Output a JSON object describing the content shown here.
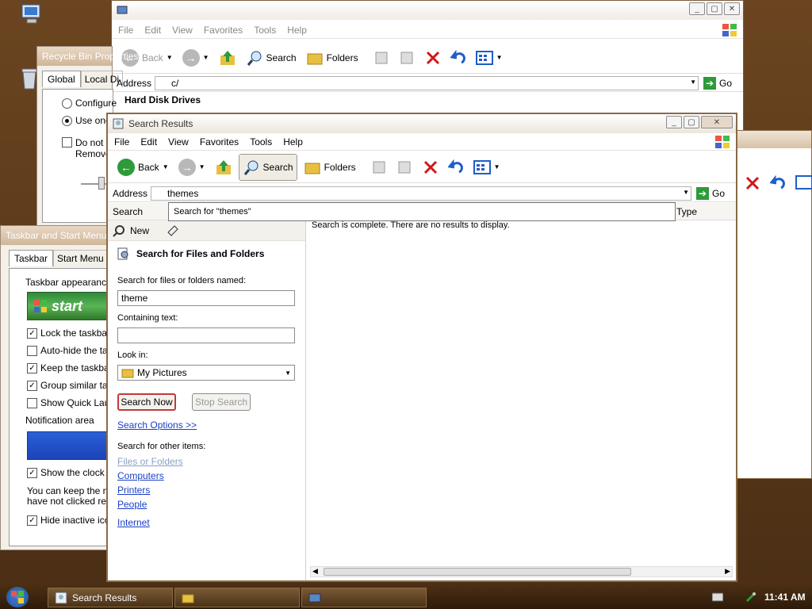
{
  "colors": {
    "accent": "#1a3fc7",
    "go": "#2e9a3a",
    "delete": "#d01818"
  },
  "back_window": {
    "menu": [
      "File",
      "Edit",
      "View",
      "Favorites",
      "Tools",
      "Help"
    ],
    "toolbar": {
      "back": "Back",
      "search": "Search",
      "folders": "Folders"
    },
    "address_label": "Address",
    "address_value": "c/",
    "go": "Go",
    "section_heading": "Hard Disk Drives"
  },
  "recycle_dialog": {
    "title": "Recycle Bin Properties",
    "tabs": [
      "Global",
      "Local Di"
    ],
    "radio1": "Configure",
    "radio2": "Use one",
    "checkbox_line1": "Do not m",
    "checkbox_line2": "Remove"
  },
  "taskbar_dialog": {
    "title": "Taskbar and Start Menu",
    "tabs": [
      "Taskbar",
      "Start Menu"
    ],
    "group1": "Taskbar appearance",
    "start_label": "start",
    "checks": [
      {
        "label": "Lock the taskbar",
        "checked": true
      },
      {
        "label": "Auto-hide the task",
        "checked": false
      },
      {
        "label": "Keep the taskbar",
        "checked": true
      },
      {
        "label": "Group similar task",
        "checked": true
      },
      {
        "label": "Show Quick Laun",
        "checked": false
      }
    ],
    "group2": "Notification area",
    "show_clock": "Show the clock",
    "note_line1": "You can keep the no",
    "note_line2": "have not clicked rece",
    "hide_inactive": "Hide inactive icon"
  },
  "search_window": {
    "title": "Search Results",
    "menu": [
      "File",
      "Edit",
      "View",
      "Favorites",
      "Tools",
      "Help"
    ],
    "toolbar": {
      "back": "Back",
      "search": "Search",
      "folders": "Folders"
    },
    "address_label": "Address",
    "address_value": "themes",
    "go": "Go",
    "autocomplete": "Search for \"themes\"",
    "pane_header": "Search",
    "column_type": "Type",
    "new_label": "New",
    "panel_title": "Search for Files and Folders",
    "named_label": "Search for files or folders named:",
    "named_value": "theme",
    "containing_label": "Containing text:",
    "containing_value": "",
    "lookin_label": "Look in:",
    "lookin_value": "My Pictures",
    "search_now": "Search Now",
    "stop_search": "Stop Search",
    "search_options": "Search Options >>",
    "other_items": "Search for other items:",
    "links": [
      "Files or Folders",
      "Computers",
      "Printers",
      "People"
    ],
    "internet": "Internet",
    "status": "Search is complete. There are no results to display."
  },
  "taskbar": {
    "item_search": "Search Results",
    "time": "11:41 AM"
  }
}
